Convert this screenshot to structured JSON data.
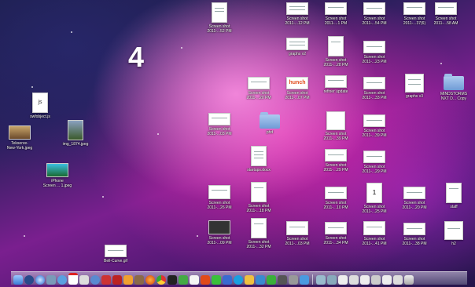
{
  "desktop": {
    "space_number": "4"
  },
  "icons": [
    {
      "label": "Screen shot\n2011-...52 PM",
      "kind": "thumb-tall"
    },
    {
      "label": "Screen shot\n2011-...12 PM",
      "kind": "thumb-wide"
    },
    {
      "label": "Screen shot\n2011-...1 PM",
      "kind": "thumb-wide"
    },
    {
      "label": "Screen shot\n2011-...54 PM",
      "kind": "thumb-wide"
    },
    {
      "label": "Screen shot\n2011-...37(6)",
      "kind": "thumb-wide"
    },
    {
      "label": "Screen shot\n2011-...58 AM",
      "kind": "thumb-wide"
    },
    {
      "label": "graphs v2",
      "kind": "thumb-wide"
    },
    {
      "label": "Screen shot\n2011-...28 PM",
      "kind": "thumb-tall"
    },
    {
      "label": "Screen shot\n2011-...23 PM",
      "kind": "thumb-wide"
    },
    {
      "label": "swfobject.js",
      "kind": "js"
    },
    {
      "label": "Screen shot\n2011-...20 PM",
      "kind": "thumb-wide"
    },
    {
      "label": "Screen shot\n2011-...07 PM",
      "kind": "hunch"
    },
    {
      "label": "refiner update",
      "kind": "thumb-wide"
    },
    {
      "label": "Screen shot\n2011-...33 PM",
      "kind": "thumb-wide"
    },
    {
      "label": "graphs v3",
      "kind": "thumb-doc"
    },
    {
      "label": "MINDSTORMS\nNXT D... Copy",
      "kind": "folder"
    },
    {
      "label": "Tekserve-\nNew-York.jpeg",
      "kind": "img"
    },
    {
      "label": "img_1874.jpeg",
      "kind": "img2"
    },
    {
      "label": "Screen shot\n2011-...03 PM",
      "kind": "thumb-wide"
    },
    {
      "label": "phd",
      "kind": "folder"
    },
    {
      "label": "Screen shot\n2011-...39 PM",
      "kind": "thumb-doc"
    },
    {
      "label": "Screen shot\n2011-...39 PM",
      "kind": "thumb-wide"
    },
    {
      "label": "startups.docx",
      "kind": "thumb-tall"
    },
    {
      "label": "Screen shot\n2011-...29 PM",
      "kind": "thumb-wide"
    },
    {
      "label": "Screen shot\n2011-...29 PM",
      "kind": "thumb-wide"
    },
    {
      "label": "iPhone\nScreen ... 1.jpeg",
      "kind": "img3"
    },
    {
      "label": "Screen shot\n2011-...26 PM",
      "kind": "thumb-wide"
    },
    {
      "label": "Screen shot\n2011-...18 PM",
      "kind": "thumb-tall"
    },
    {
      "label": "Screen shot\n2011-...10 PM",
      "kind": "thumb-wide"
    },
    {
      "label": "Screen shot\n2011-...25 PM",
      "kind": "thumb-tall"
    },
    {
      "label": "Screen shot\n2011-...20 PM",
      "kind": "thumb-wide"
    },
    {
      "label": "staff",
      "kind": "thumb-tall"
    },
    {
      "label": "Screen shot\n2011-...09 PM",
      "kind": "thumb-dark"
    },
    {
      "label": "Screen shot\n2011-...32 PM",
      "kind": "thumb-tall"
    },
    {
      "label": "Screen shot\n2011-...03 PM",
      "kind": "thumb-wide"
    },
    {
      "label": "Screen shot\n2011-...34 PM",
      "kind": "thumb-wide"
    },
    {
      "label": "Screen shot\n2011-...41 PM",
      "kind": "thumb-wide"
    },
    {
      "label": "Screen shot\n2011-...38 PM",
      "kind": "thumb-wide"
    },
    {
      "label": "h2",
      "kind": "thumb-doc"
    },
    {
      "label": "Bell-Curve.gif",
      "kind": "thumb-wide"
    }
  ],
  "dock": {
    "items": [
      "finder",
      "dashboard",
      "safari",
      "mail",
      "ichat",
      "calendar",
      "preview",
      "itunes",
      "iphoto",
      "photobooth",
      "garageband",
      "imovie",
      "firefox",
      "chrome",
      "terminal",
      "activity",
      "textedit",
      "ical",
      "adium",
      "xcode",
      "skype",
      "pages",
      "keynote",
      "numbers",
      "aperture",
      "preferences",
      "app-store",
      "separator",
      "downloads",
      "documents",
      "stack-1",
      "stack-2",
      "stack-3",
      "stack-4",
      "stack-5",
      "stack-6",
      "trash"
    ]
  }
}
